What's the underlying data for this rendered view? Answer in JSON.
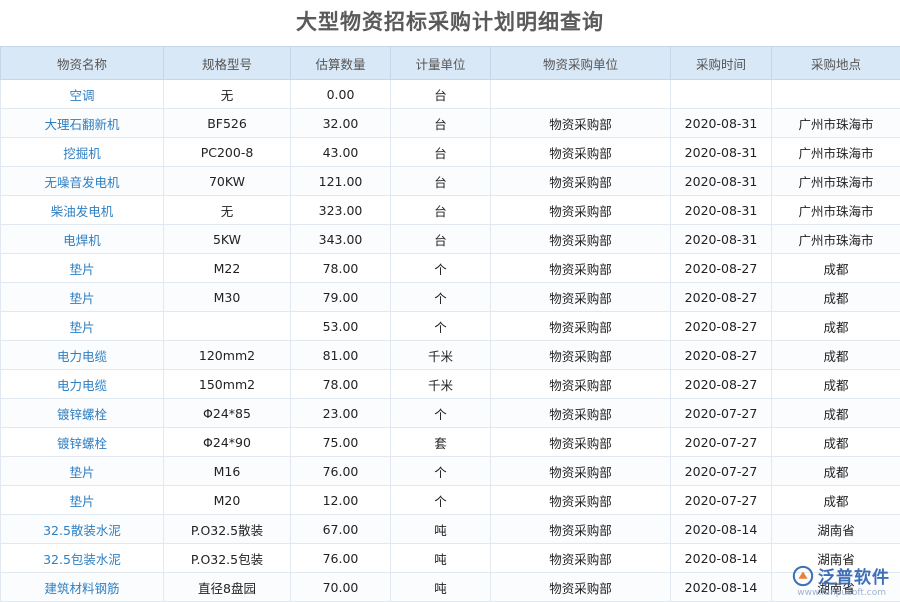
{
  "title": "大型物资招标采购计划明细查询",
  "columns": [
    "物资名称",
    "规格型号",
    "估算数量",
    "计量单位",
    "物资采购单位",
    "采购时间",
    "采购地点"
  ],
  "rows": [
    {
      "name": "空调",
      "spec": "无",
      "qty": "0.00",
      "unit": "台",
      "dept": "",
      "date": "",
      "place": ""
    },
    {
      "name": "大理石翻新机",
      "spec": "BF526",
      "qty": "32.00",
      "unit": "台",
      "dept": "物资采购部",
      "date": "2020-08-31",
      "place": "广州市珠海市"
    },
    {
      "name": "挖掘机",
      "spec": "PC200-8",
      "qty": "43.00",
      "unit": "台",
      "dept": "物资采购部",
      "date": "2020-08-31",
      "place": "广州市珠海市"
    },
    {
      "name": "无噪音发电机",
      "spec": "70KW",
      "qty": "121.00",
      "unit": "台",
      "dept": "物资采购部",
      "date": "2020-08-31",
      "place": "广州市珠海市"
    },
    {
      "name": "柴油发电机",
      "spec": "无",
      "qty": "323.00",
      "unit": "台",
      "dept": "物资采购部",
      "date": "2020-08-31",
      "place": "广州市珠海市"
    },
    {
      "name": "电焊机",
      "spec": "5KW",
      "qty": "343.00",
      "unit": "台",
      "dept": "物资采购部",
      "date": "2020-08-31",
      "place": "广州市珠海市"
    },
    {
      "name": "垫片",
      "spec": "M22",
      "qty": "78.00",
      "unit": "个",
      "dept": "物资采购部",
      "date": "2020-08-27",
      "place": "成都"
    },
    {
      "name": "垫片",
      "spec": "M30",
      "qty": "79.00",
      "unit": "个",
      "dept": "物资采购部",
      "date": "2020-08-27",
      "place": "成都"
    },
    {
      "name": "垫片",
      "spec": "",
      "qty": "53.00",
      "unit": "个",
      "dept": "物资采购部",
      "date": "2020-08-27",
      "place": "成都"
    },
    {
      "name": "电力电缆",
      "spec": "120mm2",
      "qty": "81.00",
      "unit": "千米",
      "dept": "物资采购部",
      "date": "2020-08-27",
      "place": "成都"
    },
    {
      "name": "电力电缆",
      "spec": "150mm2",
      "qty": "78.00",
      "unit": "千米",
      "dept": "物资采购部",
      "date": "2020-08-27",
      "place": "成都"
    },
    {
      "name": "镀锌螺栓",
      "spec": "Φ24*85",
      "qty": "23.00",
      "unit": "个",
      "dept": "物资采购部",
      "date": "2020-07-27",
      "place": "成都"
    },
    {
      "name": "镀锌螺栓",
      "spec": "Φ24*90",
      "qty": "75.00",
      "unit": "套",
      "dept": "物资采购部",
      "date": "2020-07-27",
      "place": "成都"
    },
    {
      "name": "垫片",
      "spec": "M16",
      "qty": "76.00",
      "unit": "个",
      "dept": "物资采购部",
      "date": "2020-07-27",
      "place": "成都"
    },
    {
      "name": "垫片",
      "spec": "M20",
      "qty": "12.00",
      "unit": "个",
      "dept": "物资采购部",
      "date": "2020-07-27",
      "place": "成都"
    },
    {
      "name": "32.5散装水泥",
      "spec": "P.O32.5散装",
      "qty": "67.00",
      "unit": "吨",
      "dept": "物资采购部",
      "date": "2020-08-14",
      "place": "湖南省"
    },
    {
      "name": "32.5包装水泥",
      "spec": "P.O32.5包装",
      "qty": "76.00",
      "unit": "吨",
      "dept": "物资采购部",
      "date": "2020-08-14",
      "place": "湖南省"
    },
    {
      "name": "建筑材料钢筋",
      "spec": "直径8盘园",
      "qty": "70.00",
      "unit": "吨",
      "dept": "物资采购部",
      "date": "2020-08-14",
      "place": "湖南省"
    }
  ],
  "watermark": {
    "text": "泛普软件",
    "url": "www.fanpusoft.com",
    "icon": "fanpu-logo-icon",
    "color": "#2f63b3"
  }
}
